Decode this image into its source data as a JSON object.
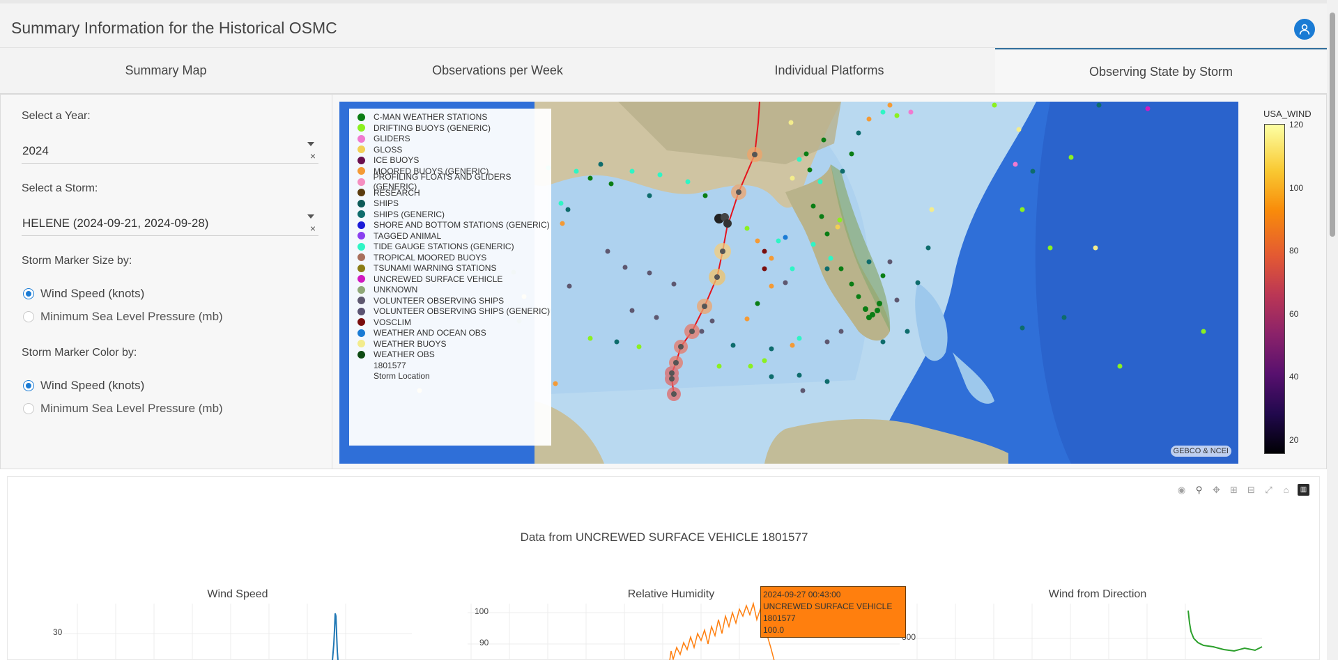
{
  "header": {
    "title": "Summary Information for the Historical OSMC"
  },
  "tabs": [
    {
      "label": "Summary Map"
    },
    {
      "label": "Observations per Week"
    },
    {
      "label": "Individual Platforms"
    },
    {
      "label": "Observing State by Storm"
    }
  ],
  "sidebar": {
    "year_label": "Select a Year:",
    "year_value": "2024",
    "storm_label": "Select a Storm:",
    "storm_value": "HELENE (2024-09-21, 2024-09-28)",
    "size_label": "Storm Marker Size by:",
    "size_options": [
      "Wind Speed (knots)",
      "Minimum Sea Level Pressure (mb)"
    ],
    "size_selected": "Wind Speed (knots)",
    "color_label": "Storm Marker Color by:",
    "color_options": [
      "Wind Speed (knots)",
      "Minimum Sea Level Pressure (mb)"
    ],
    "color_selected": "Wind Speed (knots)",
    "clear_symbol": "×"
  },
  "map": {
    "legend": [
      {
        "label": "C-MAN WEATHER STATIONS",
        "color": "#0a7d14"
      },
      {
        "label": "DRIFTING BUOYS (GENERIC)",
        "color": "#8bf020"
      },
      {
        "label": "GLIDERS",
        "color": "#f07ad0"
      },
      {
        "label": "GLOSS",
        "color": "#f2cf55"
      },
      {
        "label": "ICE BUOYS",
        "color": "#6a0f4e"
      },
      {
        "label": "MOORED BUOYS (GENERIC)",
        "color": "#f49a35"
      },
      {
        "label": "PROFILING FLOATS AND GLIDERS (GENERIC)",
        "color": "#f58ec0"
      },
      {
        "label": "RESEARCH",
        "color": "#5b3b0e"
      },
      {
        "label": "SHIPS",
        "color": "#0d5a58"
      },
      {
        "label": "SHIPS (GENERIC)",
        "color": "#0e6c6c"
      },
      {
        "label": "SHORE AND BOTTOM STATIONS (GENERIC)",
        "color": "#1a1ad8"
      },
      {
        "label": "TAGGED ANIMAL",
        "color": "#8a3ff0"
      },
      {
        "label": "TIDE GAUGE STATIONS (GENERIC)",
        "color": "#2ef5c5"
      },
      {
        "label": "TROPICAL MOORED BUOYS",
        "color": "#a86f5c"
      },
      {
        "label": "TSUNAMI WARNING STATIONS",
        "color": "#8b7d16"
      },
      {
        "label": "UNCREWED SURFACE VEHICLE",
        "color": "#d01ac0"
      },
      {
        "label": "UNKNOWN",
        "color": "#8fa878"
      },
      {
        "label": "VOLUNTEER OBSERVING SHIPS",
        "color": "#5e5870"
      },
      {
        "label": "VOLUNTEER OBSERVING SHIPS (GENERIC)",
        "color": "#5a5372"
      },
      {
        "label": "VOSCLIM",
        "color": "#7a0d0d"
      },
      {
        "label": "WEATHER AND OCEAN OBS",
        "color": "#1a7bd4"
      },
      {
        "label": "WEATHER BUOYS",
        "color": "#f3ec8c"
      },
      {
        "label": "WEATHER OBS",
        "color": "#0d4a12"
      },
      {
        "label": "1801577",
        "color": ""
      },
      {
        "label": "Storm Location",
        "color": ""
      }
    ],
    "attribution": "GEBCO & NCEI",
    "colorbar": {
      "title": "USA_WIND",
      "ticks": [
        "120",
        "100",
        "80",
        "60",
        "40",
        "20"
      ]
    }
  },
  "plot": {
    "title": "Data from UNCREWED SURFACE VEHICLE 1801577",
    "subplots": [
      "Wind Speed",
      "Relative Humidity",
      "Wind from Direction"
    ],
    "wind_tick": "30",
    "rh_ticks": [
      "100",
      "90"
    ],
    "dir_tick": "300",
    "tooltip": {
      "time": "2024-09-27 00:43:00",
      "platform": "UNCREWED SURFACE VEHICLE",
      "id": "1801577",
      "value": "100.0"
    }
  },
  "modebar": [
    "camera-icon",
    "zoom-icon",
    "pan-icon",
    "zoom-in-icon",
    "zoom-out-icon",
    "autoscale-icon",
    "reset-icon",
    "plotly-logo-icon"
  ]
}
